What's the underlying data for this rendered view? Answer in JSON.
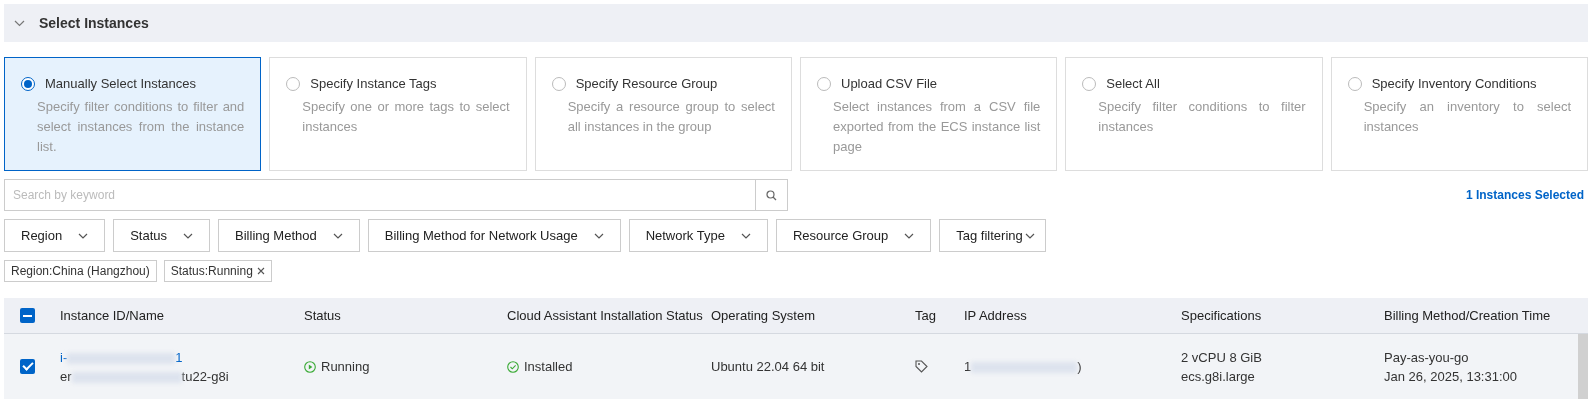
{
  "section": {
    "title": "Select Instances",
    "expanded": true
  },
  "methods": [
    {
      "label": "Manually Select Instances",
      "description": "Specify filter conditions to filter and select instances from the instance list.",
      "selected": true
    },
    {
      "label": "Specify Instance Tags",
      "description": "Specify one or more tags to select instances",
      "selected": false
    },
    {
      "label": "Specify Resource Group",
      "description": "Specify a resource group to select all instances in the group",
      "selected": false
    },
    {
      "label": "Upload CSV File",
      "description": "Select instances from a CSV file exported from the ECS instance list page",
      "selected": false
    },
    {
      "label": "Select All",
      "description": "Specify filter conditions to filter instances",
      "selected": false
    },
    {
      "label": "Specify Inventory Conditions",
      "description": "Specify an inventory to select instances",
      "selected": false
    }
  ],
  "search": {
    "placeholder": "Search by keyword"
  },
  "selected_count": "1 Instances Selected",
  "filters": [
    "Region",
    "Status",
    "Billing Method",
    "Billing Method for Network Usage",
    "Network Type",
    "Resource Group",
    "Tag filtering"
  ],
  "active_filters": [
    {
      "label": "Region:China (Hangzhou)",
      "removable": false
    },
    {
      "label": "Status:Running",
      "removable": true
    }
  ],
  "table": {
    "select_all_indeterminate": true,
    "columns": [
      "Instance ID/Name",
      "Status",
      "Cloud Assistant Installation Status",
      "Operating System",
      "Tag",
      "IP Address",
      "Specifications",
      "Billing Method/Creation Time"
    ],
    "rows": [
      {
        "checked": true,
        "id_start": "i-",
        "id_end": "1",
        "name_start": "er",
        "name_end": "tu22-g8i",
        "status": "Running",
        "assistant": "Installed",
        "os": "Ubuntu 22.04 64 bit",
        "ip_start": "1",
        "ip_end": ")",
        "spec": "2 vCPU 8 GiB",
        "type": "ecs.g8i.large",
        "billing": "Pay-as-you-go",
        "created": "Jan 26, 2025, 13:31:00"
      }
    ]
  }
}
